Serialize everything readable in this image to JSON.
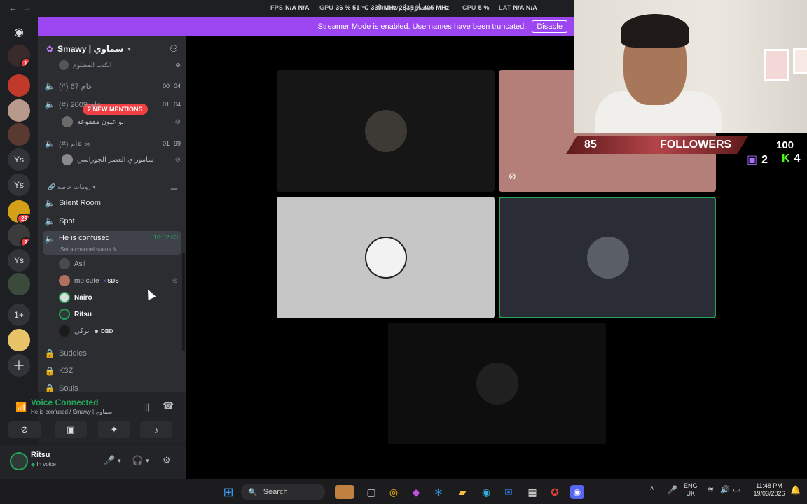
{
  "titlebar": {
    "back": "←",
    "forward": "→",
    "window_title": "Smawy | سماوي",
    "perf": [
      {
        "label": "FPS",
        "value": "N/A N/A"
      },
      {
        "label": "GPU",
        "value": "36 % 51 °C 330 MHz 2835 % 405 MHz"
      },
      {
        "label": "CPU",
        "value": "5 %"
      },
      {
        "label": "LAT",
        "value": "N/A N/A"
      }
    ]
  },
  "banner": {
    "message": "Streamer Mode is enabled. Usernames have been truncated.",
    "button": "Disable"
  },
  "rail": {
    "badges": [
      "1",
      "29",
      "2"
    ],
    "text_items": [
      "Ys",
      "Ys",
      "Ys",
      "1+"
    ]
  },
  "server": {
    "name": "Smawy | سماوي"
  },
  "mentions": "2 NEW MENTIONS",
  "channels_top": [
    {
      "name": "الكتب المظلوم",
      "right": ""
    },
    {
      "name": "(#) عام 67",
      "right1": "00",
      "right2": "04"
    },
    {
      "name": "(#) عام 2009",
      "right1": "01",
      "right2": "04"
    },
    {
      "name": "ابو عيون مفقوعه",
      "right": ""
    },
    {
      "name": "(#) عام ∞",
      "right1": "01",
      "right2": "99"
    },
    {
      "name": "ساموراي العصر الجوراسي",
      "right": ""
    }
  ],
  "category": "رومات خاصة",
  "channels": [
    {
      "name": "Silent Room"
    },
    {
      "name": "Spot"
    },
    {
      "name": "He is confused",
      "timer": "10:02:03",
      "status": "Set a channel status"
    }
  ],
  "voice_users": [
    {
      "name": "Asil",
      "tag": ""
    },
    {
      "name": "mo cute",
      "tag": "SDS"
    },
    {
      "name": "Nairo",
      "tag": ""
    },
    {
      "name": "Ritsu",
      "tag": ""
    },
    {
      "name": "تركي",
      "tag": "DBD"
    }
  ],
  "channels_bottom": [
    {
      "name": "Buddies"
    },
    {
      "name": "K3Z"
    },
    {
      "name": "Souls"
    }
  ],
  "voice": {
    "title": "Voice Connected",
    "subtitle": "He is confused / Smawy | سماوي"
  },
  "user": {
    "name": "Ritsu",
    "status": "In voice"
  },
  "overlay": {
    "count": "85",
    "label": "FOLLOWERS",
    "goal": "100",
    "twitch": "2",
    "kick": "4"
  },
  "taskbar": {
    "search": "Search",
    "lang1": "ENG",
    "lang2": "UK",
    "time": "11:48 PM",
    "date": "19/03/2026"
  },
  "colors": {
    "accent": "#9b46f0",
    "speaking": "#23a55a",
    "badge": "#f23f43"
  }
}
